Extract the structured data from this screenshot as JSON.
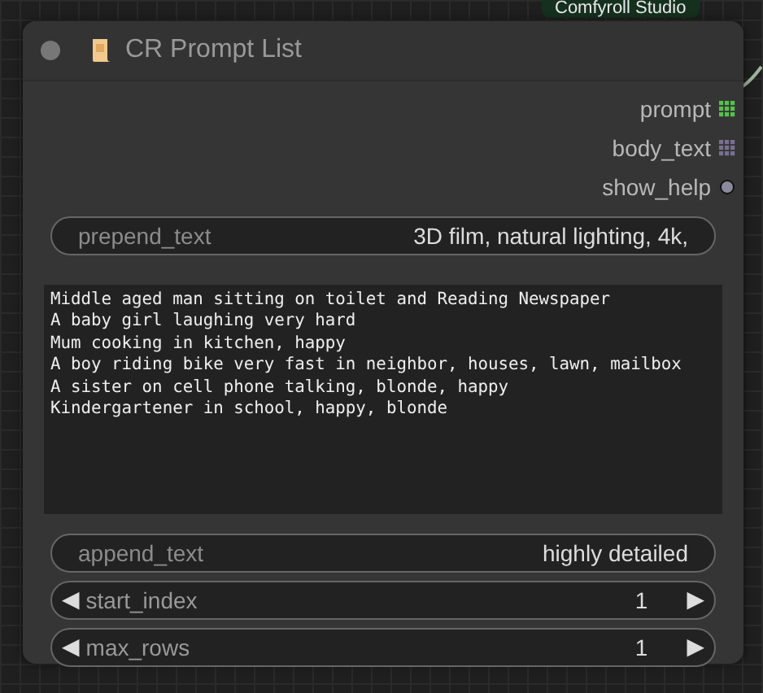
{
  "badge": {
    "label": "Comfyroll Studio"
  },
  "node": {
    "title": "CR Prompt List",
    "outputs": [
      {
        "label": "prompt",
        "kind": "grid",
        "color": "#55c24a"
      },
      {
        "label": "body_text",
        "kind": "grid",
        "color": "#77708f"
      },
      {
        "label": "show_help",
        "kind": "dot",
        "color": "#8a8a9e"
      }
    ],
    "widgets": [
      {
        "kind": "text",
        "label": "prepend_text",
        "value": "3D film, natural lighting, 4k,"
      },
      {
        "kind": "textarea",
        "value": "Middle aged man sitting on toilet and Reading Newspaper\nA baby girl laughing very hard\nMum cooking in kitchen, happy\nA boy riding bike very fast in neighbor, houses, lawn, mailbox\nA sister on cell phone talking, blonde, happy\nKindergartener in school, happy, blonde"
      },
      {
        "kind": "text",
        "label": "append_text",
        "value": "highly detailed"
      },
      {
        "kind": "number",
        "label": "start_index",
        "value": "1",
        "decrement": "◀",
        "increment": "▶"
      },
      {
        "kind": "number",
        "label": "max_rows",
        "value": "1",
        "decrement": "◀",
        "increment": "▶"
      }
    ]
  }
}
